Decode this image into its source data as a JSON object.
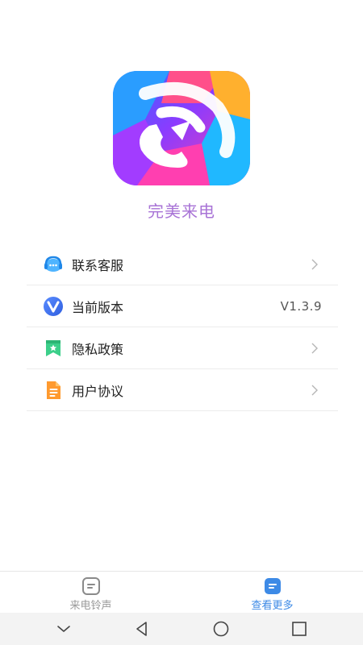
{
  "app": {
    "name": "完美来电"
  },
  "menu": {
    "items": [
      {
        "label": "联系客服",
        "icon": "headset-icon",
        "value": ""
      },
      {
        "label": "当前版本",
        "icon": "version-v-icon",
        "value": "V1.3.9"
      },
      {
        "label": "隐私政策",
        "icon": "privacy-bookmark-icon",
        "value": ""
      },
      {
        "label": "用户协议",
        "icon": "agreement-document-icon",
        "value": ""
      }
    ]
  },
  "tabbar": {
    "tabs": [
      {
        "label": "来电铃声",
        "icon": "ringtone-list-icon",
        "active": false
      },
      {
        "label": "查看更多",
        "icon": "more-list-icon",
        "active": true
      }
    ]
  },
  "colors": {
    "app_name": "#a873d6",
    "tab_active": "#3d8ae6",
    "tab_inactive": "#9a9a9a"
  },
  "system_nav": {
    "buttons": [
      "collapse-icon",
      "back-icon",
      "home-icon",
      "recents-icon"
    ]
  }
}
